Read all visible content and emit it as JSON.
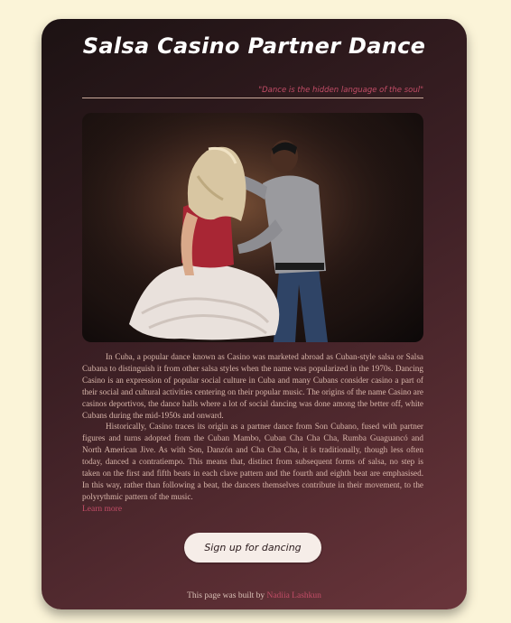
{
  "page": {
    "title": "Salsa Casino Partner Dance",
    "quote": "\"Dance is the hidden language of the soul\"",
    "image_alt": "Couple dancing salsa casino",
    "paragraphs": [
      "In Cuba, a popular dance known as Casino was marketed abroad as Cuban-style salsa or Salsa Cubana to distinguish it from other salsa styles when the name was popularized in the 1970s. Dancing Casino is an expression of popular social culture in Cuba and many Cubans consider casino a part of their social and cultural activities centering on their popular music. The origins of the name Casino are casinos deportivos, the dance halls where a lot of social dancing was done among the better off, white Cubans during the mid-1950s and onward.",
      "Historically, Casino traces its origin as a partner dance from Son Cubano, fused with partner figures and turns adopted from the Cuban Mambo, Cuban Cha Cha Cha, Rumba Guaguancó and North American Jive. As with Son, Danzón and Cha Cha Cha, it is traditionally, though less often today, danced a contratiempo. This means that, distinct from subsequent forms of salsa, no step is taken on the first and fifth beats in each clave pattern and the fourth and eighth beat are emphasised. In this way, rather than following a beat, the dancers themselves contribute in their movement, to the polyrythmic pattern of the music."
    ],
    "learn_more": "Learn more",
    "signup_label": "Sign up for dancing",
    "footer_prefix": "This page was built by",
    "footer_author": "Nadiia Lashkun"
  },
  "colors": {
    "background": "#fbf4d8",
    "accent": "#c24d67",
    "body_text": "#d9b7ab"
  }
}
